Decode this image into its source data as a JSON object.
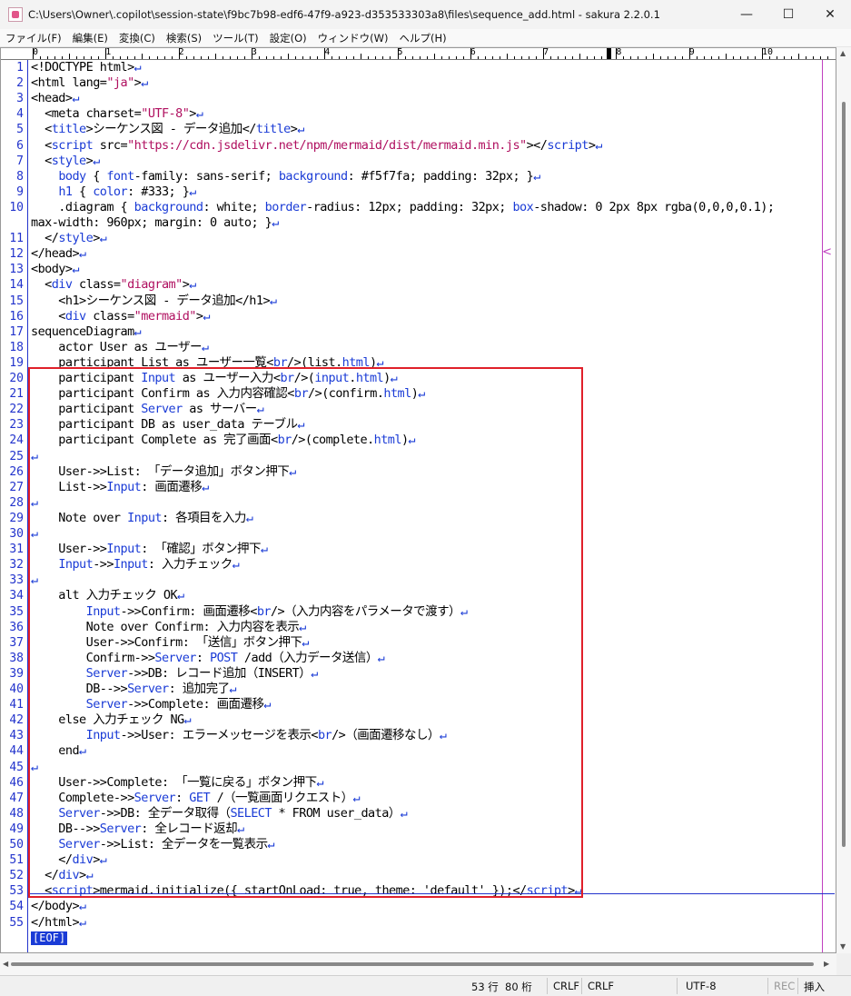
{
  "window": {
    "title": "C:\\Users\\Owner\\.copilot\\session-state\\f9bc7b98-edf6-47f9-a923-d353533303a8\\files\\sequence_add.html - sakura 2.2.0.1",
    "minimize": "—",
    "maximize": "☐",
    "close": "✕"
  },
  "menu": [
    "ファイル(F)",
    "編集(E)",
    "変換(C)",
    "検索(S)",
    "ツール(T)",
    "設定(O)",
    "ウィンドウ(W)",
    "ヘルプ(H)"
  ],
  "ruler": [
    "0",
    "1",
    "2",
    "3",
    "4",
    "5",
    "6",
    "7",
    "8",
    "9",
    "10"
  ],
  "line_numbers": [
    "1",
    "2",
    "3",
    "4",
    "5",
    "6",
    "7",
    "8",
    "9",
    "10",
    "11",
    "12",
    "13",
    "14",
    "15",
    "16",
    "17",
    "18",
    "19",
    "20",
    "21",
    "22",
    "23",
    "24",
    "25",
    "26",
    "27",
    "28",
    "29",
    "30",
    "31",
    "32",
    "33",
    "34",
    "35",
    "36",
    "37",
    "38",
    "39",
    "40",
    "41",
    "42",
    "43",
    "44",
    "45",
    "46",
    "47",
    "48",
    "49",
    "50",
    "51",
    "52",
    "53",
    "54",
    "55"
  ],
  "code_lines": [
    [
      [
        "t",
        "<!DOCTYPE html>"
      ],
      [
        "nl",
        "↵"
      ]
    ],
    [
      [
        "t",
        "<html lang="
      ],
      [
        "s",
        "\"ja\""
      ],
      [
        "t",
        ">"
      ],
      [
        "nl",
        "↵"
      ]
    ],
    [
      [
        "t",
        "<head>"
      ],
      [
        "nl",
        "↵"
      ]
    ],
    [
      [
        "t",
        "  <meta charset="
      ],
      [
        "s",
        "\"UTF-8\""
      ],
      [
        "t",
        ">"
      ],
      [
        "nl",
        "↵"
      ]
    ],
    [
      [
        "t",
        "  <"
      ],
      [
        "k",
        "title"
      ],
      [
        "t",
        ">シーケンス図 - データ追加</"
      ],
      [
        "k",
        "title"
      ],
      [
        "t",
        ">"
      ],
      [
        "nl",
        "↵"
      ]
    ],
    [
      [
        "t",
        "  <"
      ],
      [
        "k",
        "script"
      ],
      [
        "t",
        " src="
      ],
      [
        "s",
        "\"https://cdn.jsdelivr.net/npm/mermaid/dist/mermaid.min.js\""
      ],
      [
        "t",
        "></"
      ],
      [
        "k",
        "script"
      ],
      [
        "t",
        ">"
      ],
      [
        "nl",
        "↵"
      ]
    ],
    [
      [
        "t",
        "  <"
      ],
      [
        "k",
        "style"
      ],
      [
        "t",
        ">"
      ],
      [
        "nl",
        "↵"
      ]
    ],
    [
      [
        "t",
        "    "
      ],
      [
        "k",
        "body"
      ],
      [
        "t",
        " { "
      ],
      [
        "k",
        "font"
      ],
      [
        "t",
        "-family: sans-serif; "
      ],
      [
        "k",
        "background"
      ],
      [
        "t",
        ": #f5f7fa; padding: 32px; }"
      ],
      [
        "nl",
        "↵"
      ]
    ],
    [
      [
        "t",
        "    "
      ],
      [
        "k",
        "h1"
      ],
      [
        "t",
        " { "
      ],
      [
        "k",
        "color"
      ],
      [
        "t",
        ": #333; }"
      ],
      [
        "nl",
        "↵"
      ]
    ],
    [
      [
        "t",
        "    .diagram { "
      ],
      [
        "k",
        "background"
      ],
      [
        "t",
        ": white; "
      ],
      [
        "k",
        "border"
      ],
      [
        "t",
        "-radius: 12px; padding: 32px; "
      ],
      [
        "k",
        "box"
      ],
      [
        "t",
        "-shadow: 0 2px 8px rgba(0,0,0,0.1);"
      ]
    ],
    [
      [
        "t",
        "  </"
      ],
      [
        "k",
        "style"
      ],
      [
        "t",
        ">"
      ],
      [
        "nl",
        "↵"
      ]
    ],
    [
      [
        "t",
        "</head>"
      ],
      [
        "nl",
        "↵"
      ]
    ],
    [
      [
        "t",
        "<body>"
      ],
      [
        "nl",
        "↵"
      ]
    ],
    [
      [
        "t",
        "  <"
      ],
      [
        "k",
        "div"
      ],
      [
        "t",
        " class="
      ],
      [
        "s",
        "\"diagram\""
      ],
      [
        "t",
        ">"
      ],
      [
        "nl",
        "↵"
      ]
    ],
    [
      [
        "t",
        "    <h1>シーケンス図 - データ追加</h1>"
      ],
      [
        "nl",
        "↵"
      ]
    ],
    [
      [
        "t",
        "    <"
      ],
      [
        "k",
        "div"
      ],
      [
        "t",
        " class="
      ],
      [
        "s",
        "\"mermaid\""
      ],
      [
        "t",
        ">"
      ],
      [
        "nl",
        "↵"
      ]
    ],
    [
      [
        "t",
        "sequenceDiagram"
      ],
      [
        "nl",
        "↵"
      ]
    ],
    [
      [
        "t",
        "    actor User as ユーザー"
      ],
      [
        "nl",
        "↵"
      ]
    ],
    [
      [
        "t",
        "    participant List as ユーザー一覧<"
      ],
      [
        "k",
        "br"
      ],
      [
        "t",
        "/>(list."
      ],
      [
        "k",
        "html"
      ],
      [
        "t",
        ")"
      ],
      [
        "nl",
        "↵"
      ]
    ],
    [
      [
        "t",
        "    participant "
      ],
      [
        "k",
        "Input"
      ],
      [
        "t",
        " as ユーザー入力<"
      ],
      [
        "k",
        "br"
      ],
      [
        "t",
        "/>("
      ],
      [
        "k",
        "input"
      ],
      [
        "t",
        "."
      ],
      [
        "k",
        "html"
      ],
      [
        "t",
        ")"
      ],
      [
        "nl",
        "↵"
      ]
    ],
    [
      [
        "t",
        "    participant Confirm as 入力内容確認<"
      ],
      [
        "k",
        "br"
      ],
      [
        "t",
        "/>(confirm."
      ],
      [
        "k",
        "html"
      ],
      [
        "t",
        ")"
      ],
      [
        "nl",
        "↵"
      ]
    ],
    [
      [
        "t",
        "    participant "
      ],
      [
        "k",
        "Server"
      ],
      [
        "t",
        " as サーバー"
      ],
      [
        "nl",
        "↵"
      ]
    ],
    [
      [
        "t",
        "    participant DB as user_data テーブル"
      ],
      [
        "nl",
        "↵"
      ]
    ],
    [
      [
        "t",
        "    participant Complete as 完了画面<"
      ],
      [
        "k",
        "br"
      ],
      [
        "t",
        "/>(complete."
      ],
      [
        "k",
        "html"
      ],
      [
        "t",
        ")"
      ],
      [
        "nl",
        "↵"
      ]
    ],
    [
      [
        "nl",
        "↵"
      ]
    ],
    [
      [
        "t",
        "    User->>List: 「データ追加」ボタン押下"
      ],
      [
        "nl",
        "↵"
      ]
    ],
    [
      [
        "t",
        "    List->>"
      ],
      [
        "k",
        "Input"
      ],
      [
        "t",
        ": 画面遷移"
      ],
      [
        "nl",
        "↵"
      ]
    ],
    [
      [
        "nl",
        "↵"
      ]
    ],
    [
      [
        "t",
        "    Note over "
      ],
      [
        "k",
        "Input"
      ],
      [
        "t",
        ": 各項目を入力"
      ],
      [
        "nl",
        "↵"
      ]
    ],
    [
      [
        "nl",
        "↵"
      ]
    ],
    [
      [
        "t",
        "    User->>"
      ],
      [
        "k",
        "Input"
      ],
      [
        "t",
        ": 「確認」ボタン押下"
      ],
      [
        "nl",
        "↵"
      ]
    ],
    [
      [
        "t",
        "    "
      ],
      [
        "k",
        "Input"
      ],
      [
        "t",
        "->>"
      ],
      [
        "k",
        "Input"
      ],
      [
        "t",
        ": 入力チェック"
      ],
      [
        "nl",
        "↵"
      ]
    ],
    [
      [
        "nl",
        "↵"
      ]
    ],
    [
      [
        "t",
        "    alt 入力チェック OK"
      ],
      [
        "nl",
        "↵"
      ]
    ],
    [
      [
        "t",
        "        "
      ],
      [
        "k",
        "Input"
      ],
      [
        "t",
        "->>Confirm: 画面遷移<"
      ],
      [
        "k",
        "br"
      ],
      [
        "t",
        "/>（入力内容をパラメータで渡す）"
      ],
      [
        "nl",
        "↵"
      ]
    ],
    [
      [
        "t",
        "        Note over Confirm: 入力内容を表示"
      ],
      [
        "nl",
        "↵"
      ]
    ],
    [
      [
        "t",
        "        User->>Confirm: 「送信」ボタン押下"
      ],
      [
        "nl",
        "↵"
      ]
    ],
    [
      [
        "t",
        "        Confirm->>"
      ],
      [
        "k",
        "Server"
      ],
      [
        "t",
        ": "
      ],
      [
        "k",
        "POST"
      ],
      [
        "t",
        " /add（入力データ送信）"
      ],
      [
        "nl",
        "↵"
      ]
    ],
    [
      [
        "t",
        "        "
      ],
      [
        "k",
        "Server"
      ],
      [
        "t",
        "->>DB: レコード追加（INSERT）"
      ],
      [
        "nl",
        "↵"
      ]
    ],
    [
      [
        "t",
        "        DB-->>"
      ],
      [
        "k",
        "Server"
      ],
      [
        "t",
        ": 追加完了"
      ],
      [
        "nl",
        "↵"
      ]
    ],
    [
      [
        "t",
        "        "
      ],
      [
        "k",
        "Server"
      ],
      [
        "t",
        "->>Complete: 画面遷移"
      ],
      [
        "nl",
        "↵"
      ]
    ],
    [
      [
        "t",
        "    else 入力チェック NG"
      ],
      [
        "nl",
        "↵"
      ]
    ],
    [
      [
        "t",
        "        "
      ],
      [
        "k",
        "Input"
      ],
      [
        "t",
        "->>User: エラーメッセージを表示<"
      ],
      [
        "k",
        "br"
      ],
      [
        "t",
        "/>（画面遷移なし）"
      ],
      [
        "nl",
        "↵"
      ]
    ],
    [
      [
        "t",
        "    end"
      ],
      [
        "nl",
        "↵"
      ]
    ],
    [
      [
        "nl",
        "↵"
      ]
    ],
    [
      [
        "t",
        "    User->>Complete: 「一覧に戻る」ボタン押下"
      ],
      [
        "nl",
        "↵"
      ]
    ],
    [
      [
        "t",
        "    Complete->>"
      ],
      [
        "k",
        "Server"
      ],
      [
        "t",
        ": "
      ],
      [
        "k",
        "GET"
      ],
      [
        "t",
        " /（一覧画面リクエスト）"
      ],
      [
        "nl",
        "↵"
      ]
    ],
    [
      [
        "t",
        "    "
      ],
      [
        "k",
        "Server"
      ],
      [
        "t",
        "->>DB: 全データ取得（"
      ],
      [
        "k",
        "SELECT"
      ],
      [
        "t",
        " * FROM user_data）"
      ],
      [
        "nl",
        "↵"
      ]
    ],
    [
      [
        "t",
        "    DB-->>"
      ],
      [
        "k",
        "Server"
      ],
      [
        "t",
        ": 全レコード返却"
      ],
      [
        "nl",
        "↵"
      ]
    ],
    [
      [
        "t",
        "    "
      ],
      [
        "k",
        "Server"
      ],
      [
        "t",
        "->>List: 全データを一覧表示"
      ],
      [
        "nl",
        "↵"
      ]
    ],
    [
      [
        "t",
        "    </"
      ],
      [
        "k",
        "div"
      ],
      [
        "t",
        ">"
      ],
      [
        "nl",
        "↵"
      ]
    ],
    [
      [
        "t",
        "  </"
      ],
      [
        "k",
        "div"
      ],
      [
        "t",
        ">"
      ],
      [
        "nl",
        "↵"
      ]
    ],
    [
      [
        "t",
        "  <"
      ],
      [
        "k",
        "script"
      ],
      [
        "t",
        ">mermaid.initialize({ startOnLoad: true, theme: 'default' });</"
      ],
      [
        "k",
        "script"
      ],
      [
        "t",
        ">"
      ],
      [
        "nl",
        "↵"
      ]
    ],
    [
      [
        "t",
        "</body>"
      ],
      [
        "nl",
        "↵"
      ]
    ],
    [
      [
        "t",
        "</html>"
      ],
      [
        "nl",
        "↵"
      ]
    ]
  ],
  "wrapped_line_10": [
    [
      "t",
      "max-width: 960px; margin: 0 auto; }"
    ],
    [
      "nl",
      "↵"
    ]
  ],
  "wrap_marker": "<",
  "eof_label": "[EOF]",
  "status": {
    "line": "53 行",
    "col": "80 桁",
    "eol1": "CRLF",
    "eol2": "CRLF",
    "encoding": "UTF-8",
    "rec": "REC",
    "mode": "挿入"
  }
}
